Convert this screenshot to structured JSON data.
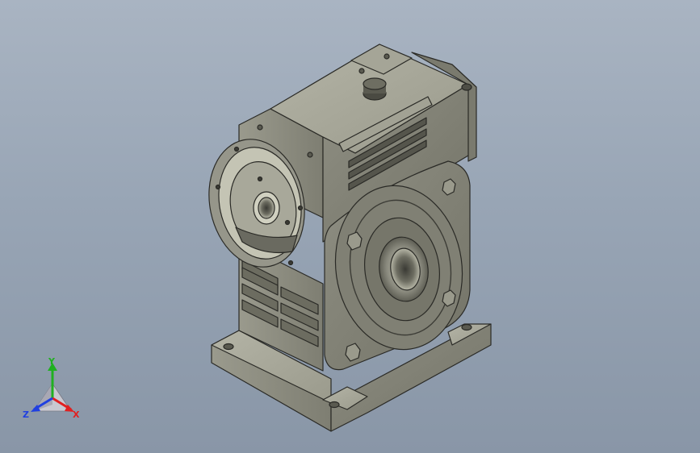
{
  "viewport": {
    "background_top": "#a9b4c2",
    "background_bottom": "#8996a7",
    "model_color": "#8c8c80",
    "model_edge_color": "#2a2a26"
  },
  "triad": {
    "x_label": "X",
    "y_label": "Y",
    "z_label": "Z",
    "x_color": "#e02020",
    "y_color": "#20b020",
    "z_color": "#2040e0"
  }
}
